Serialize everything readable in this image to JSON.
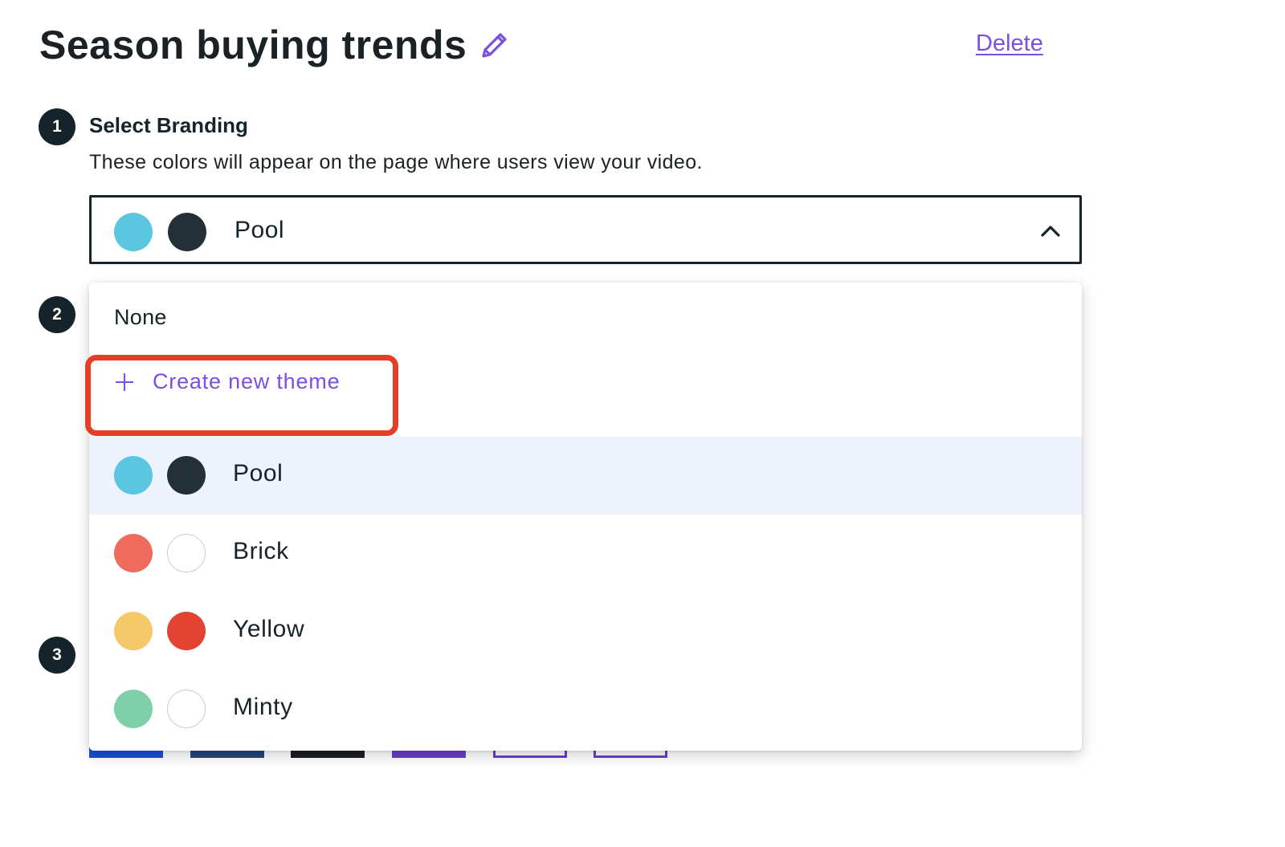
{
  "header": {
    "title": "Season buying trends",
    "delete_label": "Delete"
  },
  "steps": {
    "step1": "1",
    "step2": "2",
    "step3": "3"
  },
  "branding": {
    "title": "Select Branding",
    "description": "These colors will appear on the page where users view your video.",
    "selected": {
      "label": "Pool",
      "color_a": "#5bc6e0",
      "color_b": "#233038"
    }
  },
  "dropdown": {
    "none_label": "None",
    "create_label": "Create new theme",
    "themes": [
      {
        "label": "Pool",
        "color_a": "#5bc6e0",
        "color_b": "#233038",
        "selected": true
      },
      {
        "label": "Brick",
        "color_a": "#ee6b5e",
        "color_b": "#ffffff",
        "selected": false
      },
      {
        "label": "Yellow",
        "color_a": "#f5c96a",
        "color_b": "#e24332",
        "selected": false
      },
      {
        "label": "Minty",
        "color_a": "#7ecfaa",
        "color_b": "#ffffff",
        "selected": false
      }
    ]
  },
  "colors": {
    "accent": "#7b4fe0",
    "highlight": "#e63d26",
    "badge": "#15232a",
    "selected_row_bg": "#eef3fb"
  }
}
